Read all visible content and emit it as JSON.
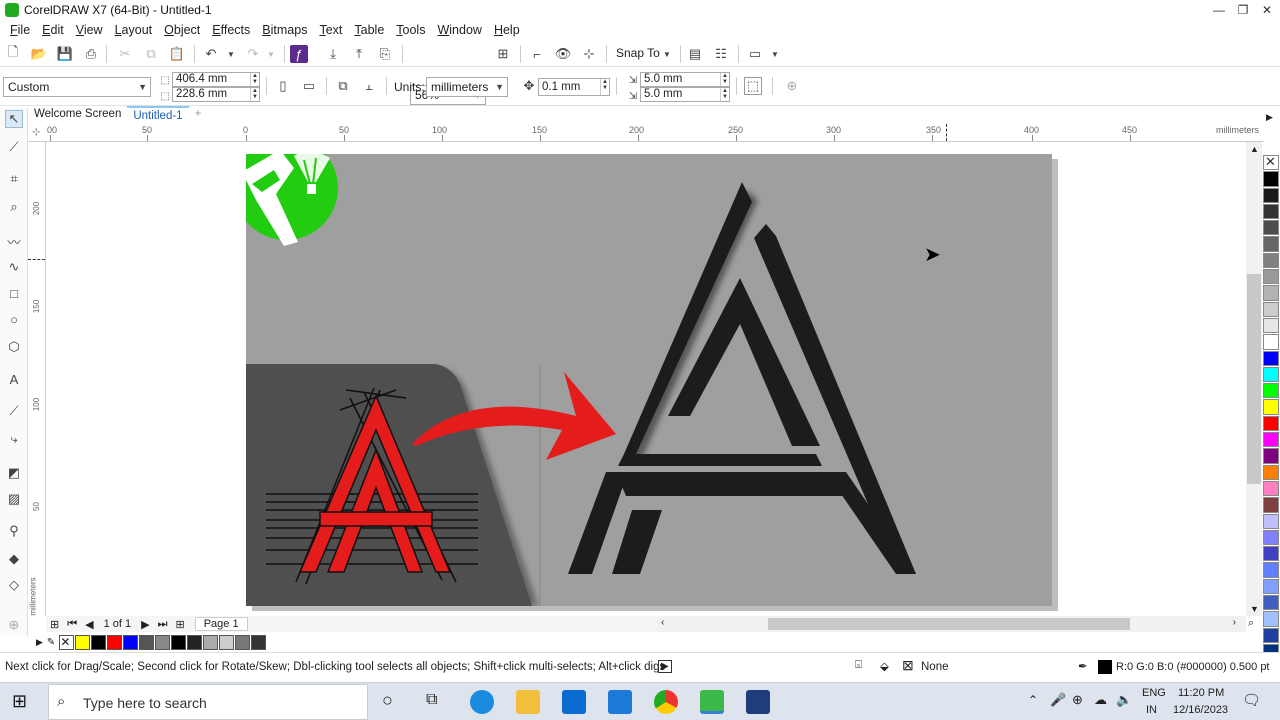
{
  "window": {
    "title": "CorelDRAW X7 (64-Bit) - Untitled-1",
    "minimize": "—",
    "restore": "❐",
    "close": "✕"
  },
  "menu": [
    "File",
    "Edit",
    "View",
    "Layout",
    "Object",
    "Effects",
    "Bitmaps",
    "Text",
    "Table",
    "Tools",
    "Window",
    "Help"
  ],
  "toolbar": {
    "zoom": "56%",
    "snap_to": "Snap To"
  },
  "propbar": {
    "page_size": "Custom",
    "width": "406.4 mm",
    "height": "228.6 mm",
    "units_label": "Units:",
    "units": "millimeters",
    "nudge": "0.1 mm",
    "dup_x": "5.0 mm",
    "dup_y": "5.0 mm"
  },
  "tabs": [
    "Welcome Screen",
    "Untitled-1"
  ],
  "ruler": {
    "h_labels": [
      "00",
      "50",
      "0",
      "50",
      "100",
      "150",
      "200",
      "250",
      "300",
      "350",
      "400",
      "450"
    ],
    "unit": "millimeters",
    "v_labels": [
      "200",
      "150",
      "100",
      "50"
    ],
    "v_unit": "millimeters"
  },
  "page_nav": {
    "count": "1 of 1",
    "page_tab": "Page 1"
  },
  "palette_colors": [
    "#000000",
    "#1a1a1a",
    "#333333",
    "#4d4d4d",
    "#666666",
    "#808080",
    "#999999",
    "#b3b3b3",
    "#cccccc",
    "#e6e6e6",
    "#ffffff",
    "#0000ff",
    "#00ffff",
    "#00ff00",
    "#ffff00",
    "#ff0000",
    "#ff00ff",
    "#800080",
    "#ff8000",
    "#ff80c0",
    "#804040",
    "#c0c0ff",
    "#8080ff",
    "#4040c0",
    "#6080ff",
    "#80a0ff",
    "#4060c0",
    "#a0c0ff",
    "#2040a0",
    "#003080"
  ],
  "doc_palette": [
    "#ffff00",
    "#000000",
    "#ff0000",
    "#0000ff",
    "#555555",
    "#888888",
    "#000000",
    "#222222",
    "#aaaaaa",
    "#cccccc",
    "#777777",
    "#333333"
  ],
  "status": {
    "hint": "Next click for Drag/Scale; Second click for Rotate/Skew; Dbl-clicking tool selects all objects; Shift+click multi-selects; Alt+click digs",
    "fill": "None",
    "outline": "R:0 G:0 B:0 (#000000)  0.500 pt"
  },
  "taskbar": {
    "search_placeholder": "Type here to search",
    "lang1": "ENG",
    "lang2": "IN",
    "time": "11:20 PM",
    "date": "12/16/2023"
  },
  "colors": {
    "page_bg": "#9f9f9f",
    "accent_red": "#e51c1c",
    "logo_green": "#22cc11"
  }
}
